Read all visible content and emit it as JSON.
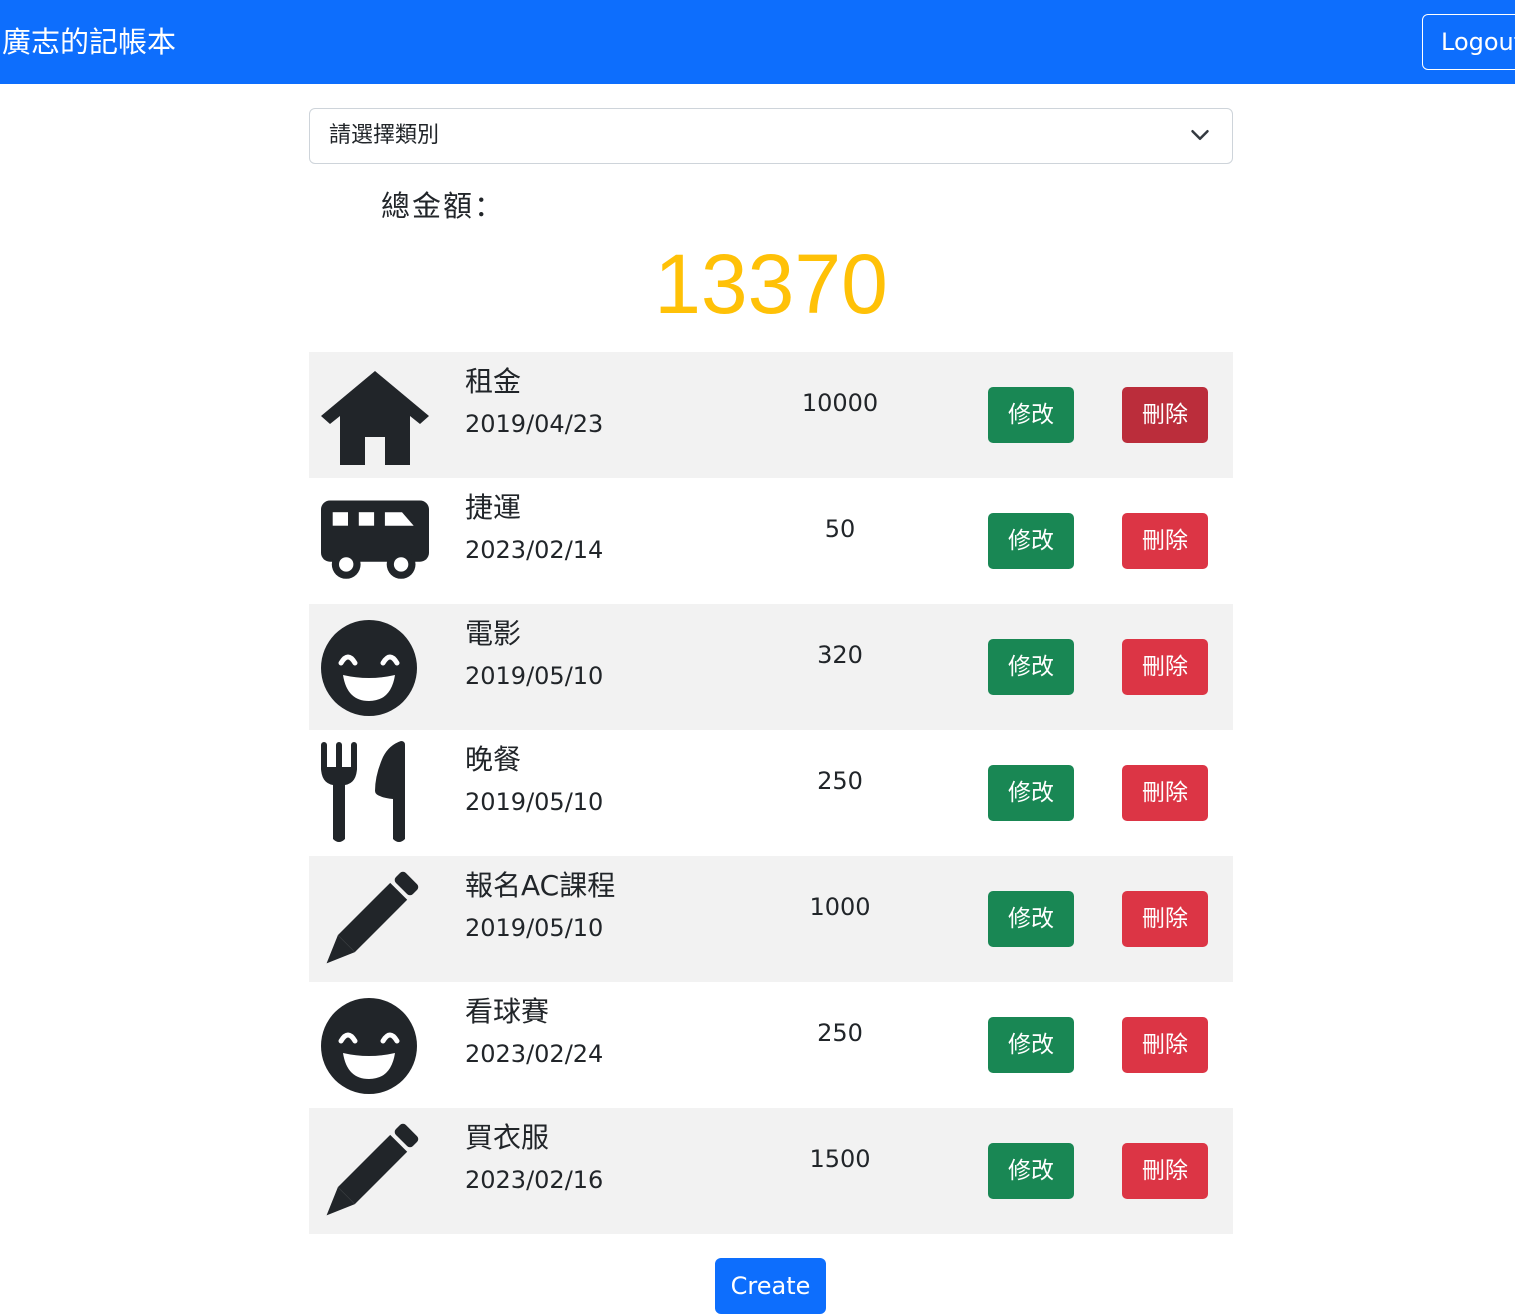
{
  "navbar": {
    "brand": "廣志的記帳本",
    "logout_label": "Logout",
    "color": "#0d6efd"
  },
  "filter": {
    "selected": "請選擇類別",
    "icon": "chevron-down-icon"
  },
  "summary": {
    "label": "總金額：",
    "total": "13370",
    "total_color": "#ffc107"
  },
  "records": [
    {
      "icon": "home-icon",
      "name": "租金",
      "date": "2019/04/23",
      "amount": "10000",
      "edit_label": "修改",
      "delete_label": "刪除"
    },
    {
      "icon": "shuttle-van-icon",
      "name": "捷運",
      "date": "2023/02/14",
      "amount": "50",
      "edit_label": "修改",
      "delete_label": "刪除"
    },
    {
      "icon": "grin-beam-icon",
      "name": "電影",
      "date": "2019/05/10",
      "amount": "320",
      "edit_label": "修改",
      "delete_label": "刪除"
    },
    {
      "icon": "utensils-icon",
      "name": "晚餐",
      "date": "2019/05/10",
      "amount": "250",
      "edit_label": "修改",
      "delete_label": "刪除"
    },
    {
      "icon": "pen-icon",
      "name": "報名AC課程",
      "date": "2019/05/10",
      "amount": "1000",
      "edit_label": "修改",
      "delete_label": "刪除"
    },
    {
      "icon": "grin-beam-icon",
      "name": "看球賽",
      "date": "2023/02/24",
      "amount": "250",
      "edit_label": "修改",
      "delete_label": "刪除"
    },
    {
      "icon": "pen-icon",
      "name": "買衣服",
      "date": "2023/02/16",
      "amount": "1500",
      "edit_label": "修改",
      "delete_label": "刪除"
    }
  ],
  "colors": {
    "edit": "#198754",
    "delete": "#dc3545",
    "delete_active": "#bb2d3b",
    "row_shade": "#f2f2f2"
  },
  "create_label": "Create"
}
